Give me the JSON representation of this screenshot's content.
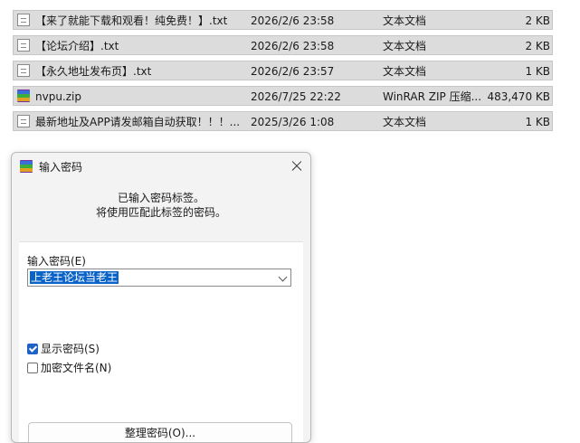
{
  "files": [
    {
      "name": "【来了就能下载和观看！纯免费！】.txt",
      "date": "2026/2/6 23:58",
      "type": "文本文档",
      "size": "2 KB",
      "icon": "text-doc-icon"
    },
    {
      "name": "【论坛介绍】.txt",
      "date": "2026/2/6 23:58",
      "type": "文本文档",
      "size": "2 KB",
      "icon": "text-doc-icon"
    },
    {
      "name": "【永久地址发布页】.txt",
      "date": "2026/2/6 23:57",
      "type": "文本文档",
      "size": "1 KB",
      "icon": "text-doc-icon"
    },
    {
      "name": "nvpu.zip",
      "date": "2026/7/25 22:22",
      "type": "WinRAR ZIP 压缩...",
      "size": "483,470 KB",
      "icon": "winrar-icon"
    },
    {
      "name": "最新地址及APP请发邮箱自动获取！！！...",
      "date": "2025/3/26 1:08",
      "type": "文本文档",
      "size": "1 KB",
      "icon": "text-doc-icon"
    }
  ],
  "dialog": {
    "title": "输入密码",
    "info_line1": "已输入密码标签。",
    "info_line2": "将使用匹配此标签的密码。",
    "password_label": "输入密码(E)",
    "password_value": "上老王论坛当老王",
    "show_password": {
      "label": "显示密码(S)",
      "checked": true
    },
    "encrypt_names": {
      "label": "加密文件名(N)",
      "checked": false
    },
    "manage_button": "整理密码(O)..."
  }
}
